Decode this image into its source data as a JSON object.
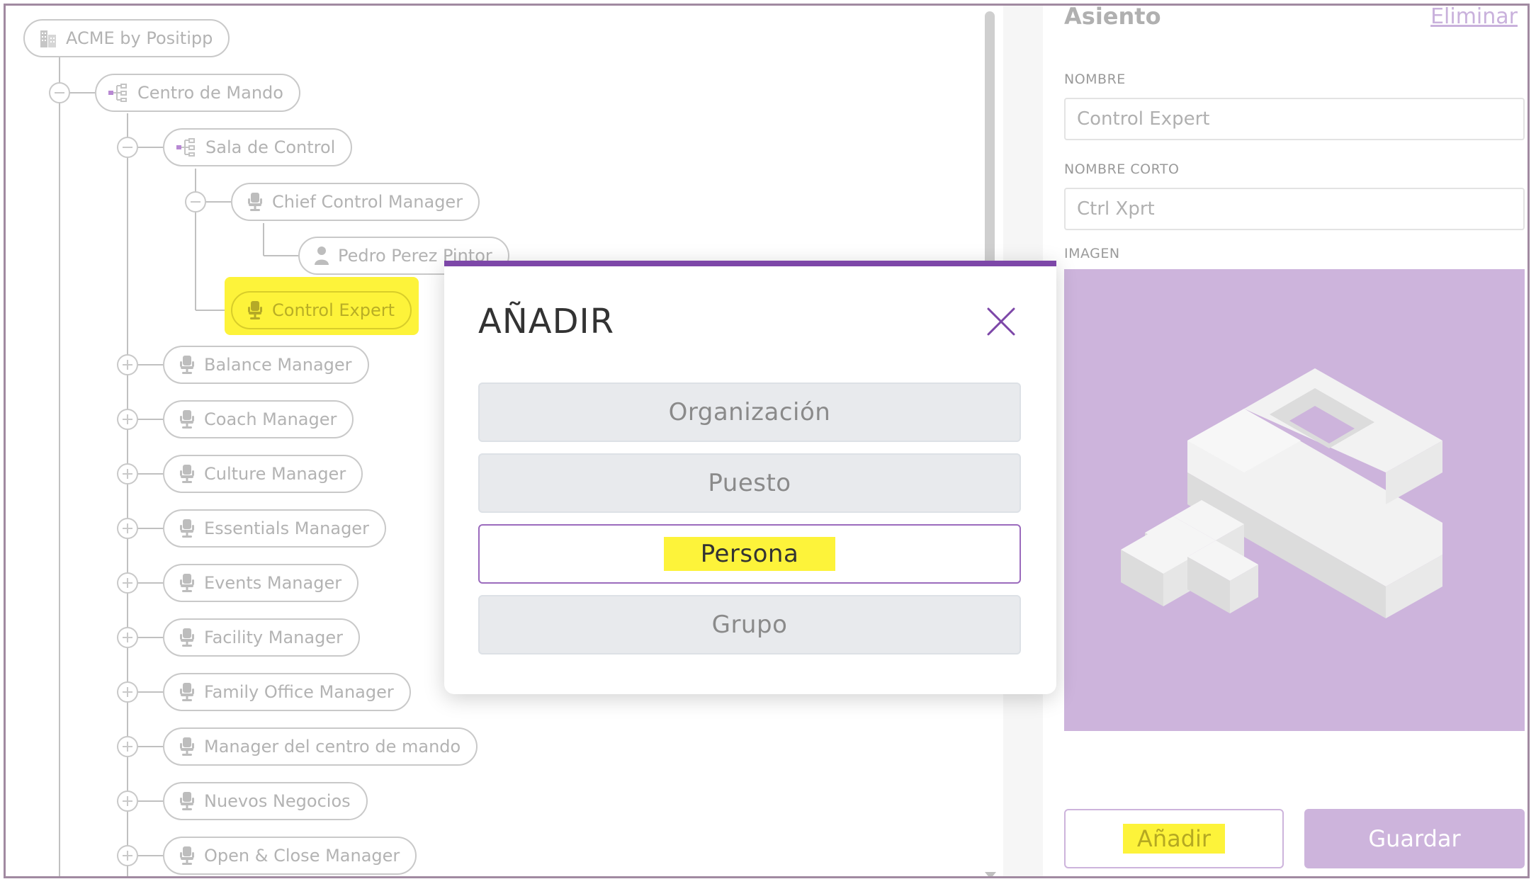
{
  "tree": {
    "root": "ACME by Positipp",
    "command_center": "Centro de Mando",
    "control_room": "Sala de Control",
    "chief": "Chief Control Manager",
    "person": "Pedro Perez Pintor",
    "selected": "Control Expert",
    "positions": [
      "Balance Manager",
      "Coach Manager",
      "Culture Manager",
      "Essentials Manager",
      "Events Manager",
      "Facility Manager",
      "Family Office Manager",
      "Manager del centro de mando",
      "Nuevos Negocios",
      "Open & Close Manager"
    ]
  },
  "panel": {
    "title": "Asiento",
    "delete_label": "Eliminar",
    "name_label": "NOMBRE",
    "name_value": "Control Expert",
    "short_name_label": "NOMBRE CORTO",
    "short_name_value": "Ctrl Xprt",
    "image_label": "IMAGEN",
    "add_button": "Añadir",
    "save_button": "Guardar"
  },
  "modal": {
    "title": "AÑADIR",
    "options": [
      "Organización",
      "Puesto",
      "Persona",
      "Grupo"
    ],
    "selected_option": "Persona"
  },
  "colors": {
    "accent": "#7d47a8",
    "soft_purple": "#cdb4dc",
    "highlight": "#fdf33a",
    "node_border": "#c9c9c9"
  },
  "icons": {
    "root": "building-icon",
    "org": "org-chart-icon",
    "seat": "chair-icon",
    "person": "person-icon",
    "close": "close-icon"
  }
}
